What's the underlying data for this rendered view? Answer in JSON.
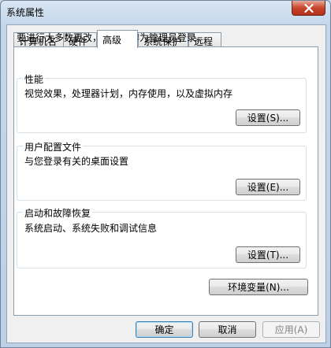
{
  "window": {
    "title": "系统属性"
  },
  "tabs": [
    {
      "label": "计算机名"
    },
    {
      "label": "硬件"
    },
    {
      "label": "高级",
      "active": true
    },
    {
      "label": "系统保护"
    },
    {
      "label": "远程"
    }
  ],
  "admin_note": "要进行大多数更改，您必须作为管理员登录。",
  "groups": {
    "performance": {
      "title": "性能",
      "desc": "视觉效果，处理器计划，内存使用，以及虚拟内存",
      "button": "设置(S)..."
    },
    "user_profiles": {
      "title": "用户配置文件",
      "desc": "与您登录有关的桌面设置",
      "button": "设置(E)..."
    },
    "startup_recovery": {
      "title": "启动和故障恢复",
      "desc": "系统启动、系统失败和调试信息",
      "button": "设置(T)..."
    }
  },
  "env_button": "环境变量(N)...",
  "footer": {
    "ok": "确定",
    "cancel": "取消",
    "apply": "应用(A)"
  },
  "icons": {
    "close": "close-icon"
  },
  "colors": {
    "close_button": "#c7452a",
    "titlebar": "#c4d7ea",
    "dialog_bg": "#f0f0f0"
  }
}
